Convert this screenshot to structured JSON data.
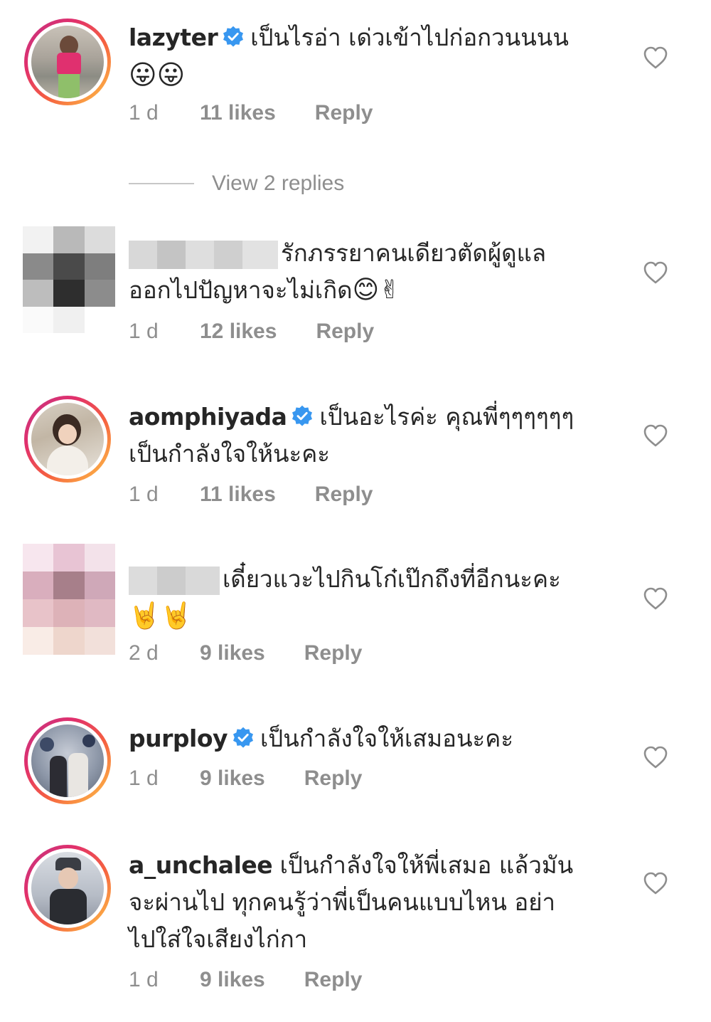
{
  "comments": [
    {
      "username": "lazyter",
      "verified": true,
      "text": "เป็นไรอ่า เด่วเข้าไปก่อกวนนนน",
      "emoji": "😛😛",
      "time": "1 d",
      "likes": "11 likes",
      "reply": "Reply"
    },
    {
      "username": "",
      "text_line1": "รักภรรยาคนเดียวตัดผู้ดูแล",
      "text_line2": "ออกไปปัญหาจะไม่เกิด",
      "emoji": "😊✌",
      "time": "1 d",
      "likes": "12 likes",
      "reply": "Reply"
    },
    {
      "username": "aomphiyada",
      "verified": true,
      "text_line1": "เป็นอะไรค่ะ คุณพี่ๆๆๆๆๆๆ",
      "text_line2": "เป็นกำลังใจให้นะคะ",
      "time": "1 d",
      "likes": "11 likes",
      "reply": "Reply"
    },
    {
      "username": "",
      "text": "เดี๋ยวแวะไปกินโก๋เป๊กถึงที่อีกนะคะ",
      "emoji": "🤘🤘",
      "time": "2 d",
      "likes": "9 likes",
      "reply": "Reply"
    },
    {
      "username": "purploy",
      "verified": true,
      "text": "เป็นกำลังใจให้เสมอนะคะ",
      "time": "1 d",
      "likes": "9 likes",
      "reply": "Reply"
    },
    {
      "username": "a_unchalee",
      "verified": false,
      "text_line1": "เป็นกำลังใจให้พี่เสมอ แล้วมัน",
      "text_line2": "จะผ่านไป ทุกคนรู้ว่าพี่เป็นคนแบบไหน อย่า",
      "text_line3": "ไปใส่ใจเสียงไก่กา",
      "time": "1 d",
      "likes": "9 likes",
      "reply": "Reply"
    }
  ],
  "view_replies": "View 2 replies",
  "colors": {
    "text": "#262626",
    "meta": "#8e8e8e",
    "verified": "#3897f0",
    "heart": "#8e8e8e"
  },
  "icons": [
    "verified-badge-icon",
    "heart-outline-icon"
  ]
}
